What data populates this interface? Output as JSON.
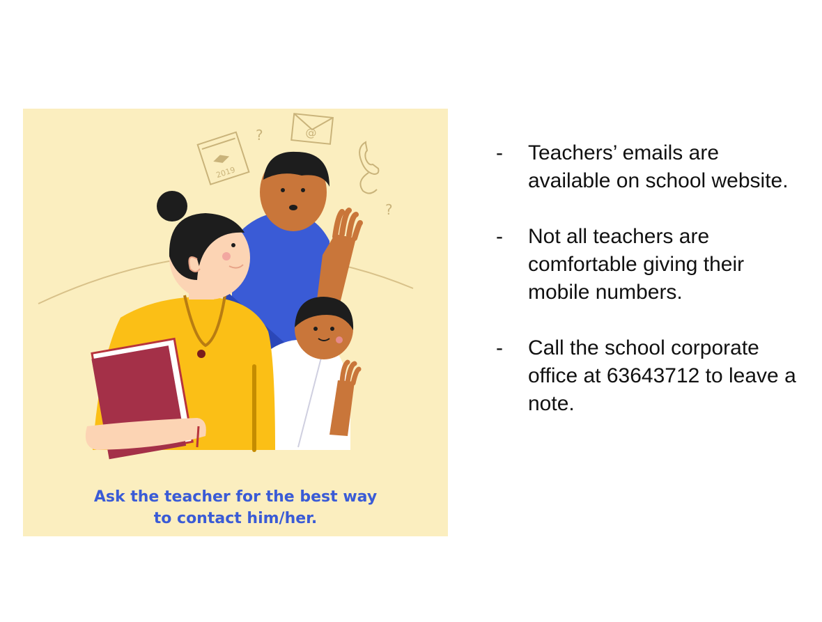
{
  "illustration": {
    "caption_line1": "Ask the teacher for the best way",
    "caption_line2": "to contact him/her.",
    "calendar_year": "2019",
    "email_symbol": "@",
    "question_mark": "?",
    "colors": {
      "panel_bg": "#fbeebf",
      "caption": "#3a5bd6",
      "teacher_top": "#fbbf16",
      "parent_shirt": "#3a5bd6",
      "book": "#b8343c"
    }
  },
  "bullets": [
    {
      "marker": "-",
      "text": "Teachers’ emails are available on school website."
    },
    {
      "marker": "-",
      "text": "Not all teachers are comfortable giving their mobile numbers."
    },
    {
      "marker": "-",
      "text": "Call the school corporate office at 63643712 to leave a note."
    }
  ]
}
